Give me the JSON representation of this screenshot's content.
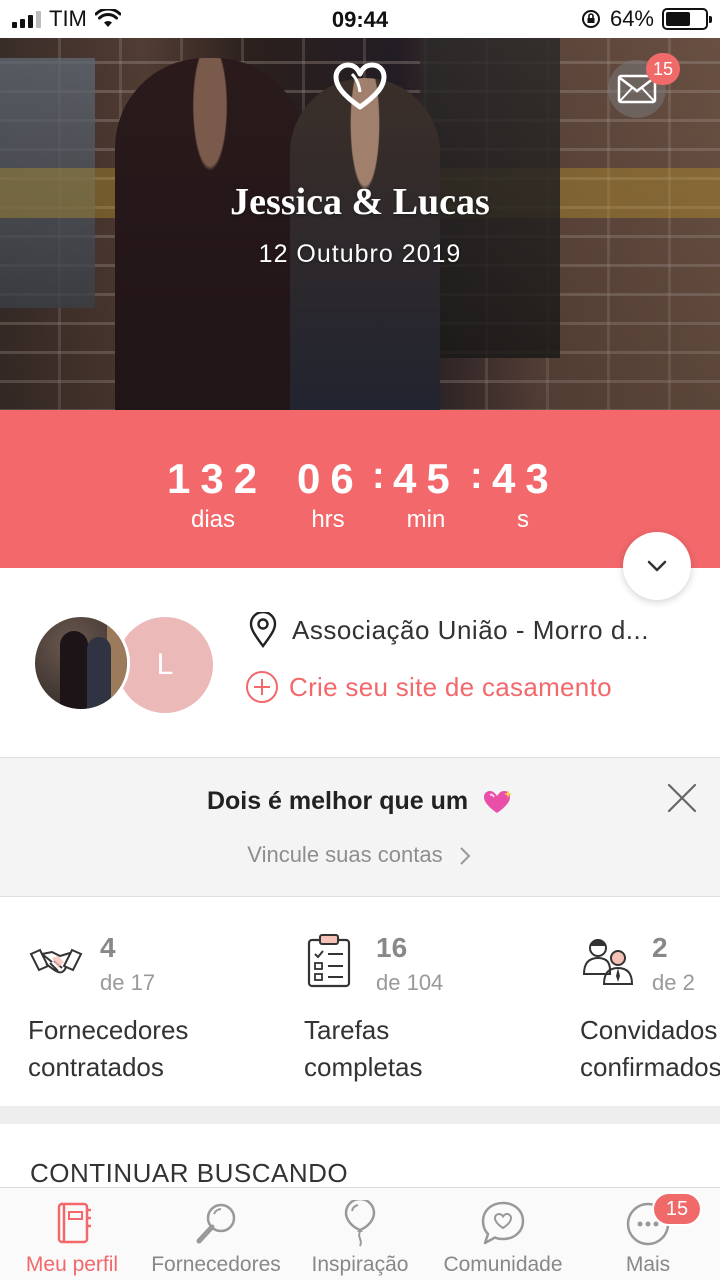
{
  "status_bar": {
    "carrier": "TIM",
    "time": "09:44",
    "battery_percent": "64%",
    "battery_level": 0.64,
    "icons": [
      "signal-icon",
      "wifi-icon",
      "orientation-lock-icon",
      "battery-icon"
    ]
  },
  "hero": {
    "couple_names": "Jessica & Lucas",
    "wedding_date": "12 Outubro 2019",
    "logo_icon": "heart-icon",
    "messages_icon": "envelope-icon",
    "messages_badge": "15"
  },
  "countdown": {
    "days": "132",
    "days_label": "dias",
    "hours": "06",
    "hours_label": "hrs",
    "minutes": "45",
    "minutes_label": "min",
    "seconds": "43",
    "seconds_label": "s",
    "separator": ":",
    "toggle_icon": "chevron-down-icon",
    "background_color": "#f2686b"
  },
  "profile": {
    "partner_initial": "L",
    "venue": "Associação União - Morro d...",
    "venue_icon": "location-pin-icon",
    "create_site_label": "Crie seu site de casamento",
    "create_site_icon": "plus-circle-icon"
  },
  "link_banner": {
    "title": "Dois é melhor que um",
    "emoji_icon": "sparkling-heart-icon",
    "link_label": "Vincule suas contas",
    "close_icon": "close-icon"
  },
  "stats": [
    {
      "icon": "handshake-icon",
      "value": "4",
      "total": "de 17",
      "label_line1": "Fornecedores",
      "label_line2": "contratados"
    },
    {
      "icon": "clipboard-checklist-icon",
      "value": "16",
      "total": "de 104",
      "label_line1": "Tarefas",
      "label_line2": "completas"
    },
    {
      "icon": "guests-icon",
      "value": "2",
      "total": "de 2",
      "label_line1": "Convidados",
      "label_line2": "confirmados"
    }
  ],
  "section": {
    "continue_searching": "CONTINUAR BUSCANDO"
  },
  "bottom_nav": {
    "items": [
      {
        "label": "Meu perfil",
        "icon": "notebook-icon",
        "active": true
      },
      {
        "label": "Fornecedores",
        "icon": "magnifier-icon",
        "active": false
      },
      {
        "label": "Inspiração",
        "icon": "balloon-icon",
        "active": false
      },
      {
        "label": "Comunidade",
        "icon": "chat-heart-icon",
        "active": false
      },
      {
        "label": "Mais",
        "icon": "more-icon",
        "active": false
      }
    ],
    "more_badge": "15"
  },
  "colors": {
    "accent": "#f2686b",
    "badge": "#f06a6a",
    "partner_avatar": "#ecb9b9",
    "muted_text": "#888888"
  }
}
